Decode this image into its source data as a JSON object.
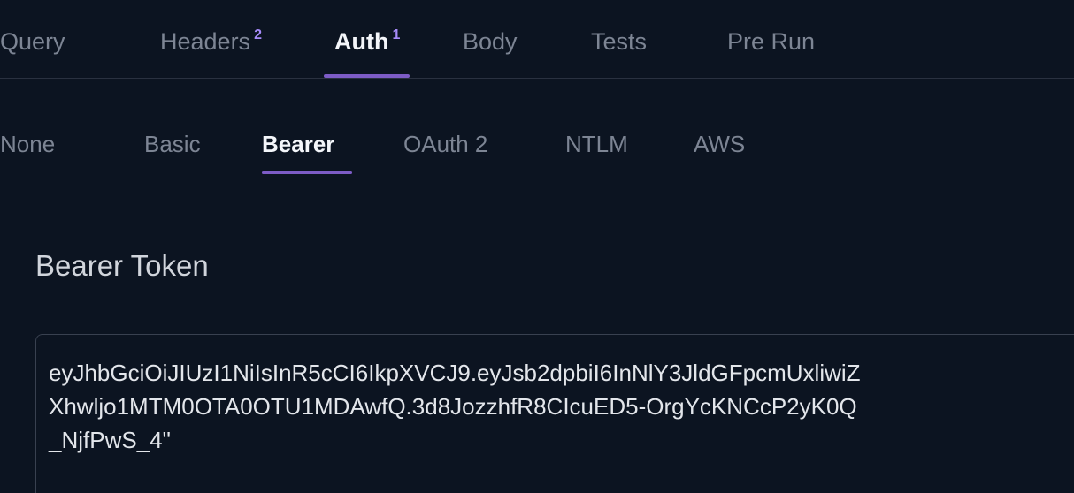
{
  "tabs": [
    {
      "label": "Query",
      "badge": ""
    },
    {
      "label": "Headers",
      "badge": "2"
    },
    {
      "label": "Auth",
      "badge": "1"
    },
    {
      "label": "Body",
      "badge": ""
    },
    {
      "label": "Tests",
      "badge": ""
    },
    {
      "label": "Pre Run",
      "badge": ""
    }
  ],
  "active_tab": "Auth",
  "auth_types": [
    "None",
    "Basic",
    "Bearer",
    "OAuth 2",
    "NTLM",
    "AWS"
  ],
  "active_auth_type": "Bearer",
  "bearer": {
    "title": "Bearer Token",
    "token_lines": [
      "eyJhbGciOiJIUzI1NiIsInR5cCI6IkpXVCJ9.eyJsb2dpbiI6InNlY3JldGFpcmUxliwiZ",
      "Xhwljo1MTM0OTA0OTU1MDAwfQ.3d8JozzhfR8CIcuED5-OrgYcKNCcP2yK0Q",
      "_NjfPwS_4\""
    ]
  },
  "colors": {
    "background": "#0c1421",
    "accent": "#7d5cc6",
    "active_text": "#f4f6fa",
    "inactive_text": "#7d8594"
  }
}
